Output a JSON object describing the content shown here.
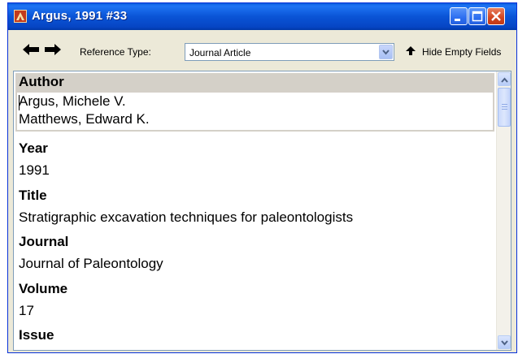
{
  "window": {
    "title": "Argus, 1991 #33",
    "icon": "endnote-app-icon",
    "controls": [
      "minimize-icon",
      "maximize-icon",
      "close-icon"
    ]
  },
  "toolbar": {
    "back_icon": "arrow-left-icon",
    "forward_icon": "arrow-right-icon",
    "reference_type_label": "Reference Type:",
    "reference_type_value": "Journal Article",
    "hide_empty_label": "Hide Empty Fields",
    "hide_empty_icon": "arrow-up-icon"
  },
  "fields": {
    "author": {
      "label": "Author",
      "values": [
        "Argus, Michele V.",
        "Matthews, Edward K."
      ]
    },
    "year": {
      "label": "Year",
      "value": "1991"
    },
    "title": {
      "label": "Title",
      "value": "Stratigraphic excavation techniques for paleontologists"
    },
    "journal": {
      "label": "Journal",
      "value": "Journal of Paleontology"
    },
    "volume": {
      "label": "Volume",
      "value": "17"
    },
    "issue": {
      "label": "Issue",
      "value": ""
    }
  },
  "scrollbar": {
    "position_fraction": 0.0
  },
  "colors": {
    "title_bar": "#0a54d6",
    "window_face": "#ece9d8",
    "field_header": "#d4d0c8",
    "close_button": "#d1441f"
  }
}
